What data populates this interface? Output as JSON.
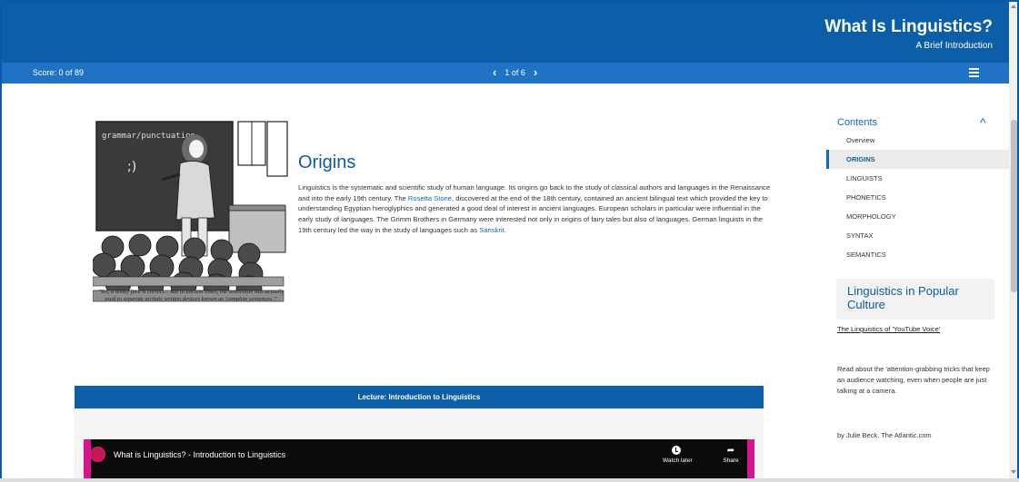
{
  "header": {
    "title": "What Is Linguistics?",
    "subtitle": "A Brief Introduction"
  },
  "navbar": {
    "score": "Score: 0 of 89",
    "page_indicator": "1 of 6",
    "prev_icon": "chevron-left-icon",
    "next_icon": "chevron-right-icon",
    "menu_icon": "hamburger-menu-icon"
  },
  "cartoon": {
    "board_text": "grammar/punctuation",
    "caption": "\"Yes, a winky face is correct... But in ancient times, the semicolon was actually used to separate archaic written devices known as 'complete sentences.'\""
  },
  "article": {
    "heading": "Origins",
    "body_part1": "Linguistics is the systematic and scientific study of human language. Its origins go back to the study of classical authors and languages in the Renaissance and into the early 19th century. The ",
    "link1": "Rosetta Stone",
    "body_part2": ", discovered at the end of the 18th century, contained an ancient bilingual text which provided the key to understanding Egyptian hieroglyphics and generated a good deal of interest in ancient languages. European scholars in particular were influential in the early study of languages. The Grimm Brothers in Germany were interested not only in origins of fairy tales but also of languages. German linguists in the 19th century led the way in the study of languages such as ",
    "link2": "Sanskrit",
    "body_part3": "."
  },
  "contents": {
    "title": "Contents",
    "items": [
      {
        "label": "Overview"
      },
      {
        "label": "ORIGINS"
      },
      {
        "label": "LINGUISTS"
      },
      {
        "label": "PHONETICS"
      },
      {
        "label": "MORPHOLOGY"
      },
      {
        "label": "SYNTAX"
      },
      {
        "label": "SEMANTICS"
      }
    ]
  },
  "popular_culture": {
    "heading": "Linguistics in Popular Culture",
    "link": "The Linguistics of 'YouTube Voice'",
    "description": "Read about the 'attention-grabbing tricks that keep an audience watching, even when people are just talking at a camera.",
    "byline": "by Julie Beck, The Atlantic.com"
  },
  "lecture": {
    "bar_label": "Lecture: Introduction to Linguistics",
    "video_title": "What is Linguistics? - Introduction to Linguistics",
    "watch_later": "Watch later",
    "share": "Share"
  },
  "colors": {
    "header": "#0c5ea8",
    "navbar": "#1f72c4",
    "accent": "#1565c0",
    "video_accent": "#d6148d"
  }
}
